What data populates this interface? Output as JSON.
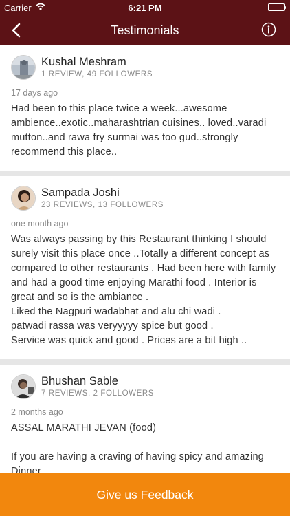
{
  "status_bar": {
    "carrier": "Carrier",
    "time": "6:21 PM"
  },
  "nav": {
    "title": "Testimonials",
    "back_icon": "chevron-left-icon",
    "info_icon": "info-icon"
  },
  "reviews": [
    {
      "name": "Kushal Meshram",
      "meta": "1 REVIEW, 49 FOLLOWERS",
      "date": "17 days ago",
      "text": "Had been to this place twice a week...awesome ambience..exotic..maharashtrian cuisines.. loved..varadi mutton..and rawa fry surmai was too gud..strongly recommend this place.."
    },
    {
      "name": "Sampada Joshi",
      "meta": "23 REVIEWS, 13 FOLLOWERS",
      "date": "one month ago",
      "text": "Was always passing by this Restaurant thinking I should surely visit this place once ..Totally a different concept as compared to other restaurants . Had been here with family and had a good time enjoying Marathi food . Interior is great and so is the ambiance .\nLiked the Nagpuri wadabhat and  alu chi wadi .\npatwadi rassa was veryyyyy spice but good .\nService was  quick and good . Prices are a bit high .."
    },
    {
      "name": "Bhushan Sable",
      "meta": "7 REVIEWS, 2 FOLLOWERS",
      "date": "2 months ago",
      "text": "ASSAL MARATHI JEVAN (food)\n\nIf you are  having a craving of having spicy and amazing Dinner"
    }
  ],
  "footer": {
    "label": "Give us Feedback"
  },
  "colors": {
    "nav_bg": "#5c1216",
    "footer_bg": "#f2870d",
    "divider": "#e6e6e6"
  }
}
